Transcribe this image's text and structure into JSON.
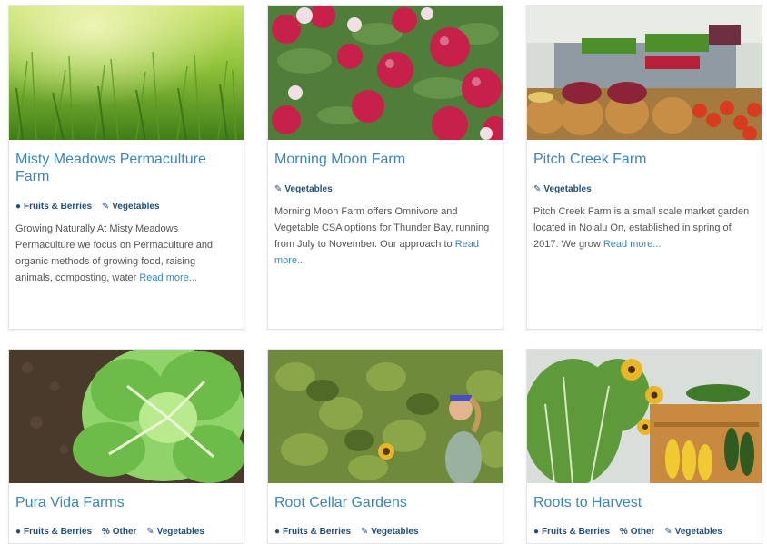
{
  "cards": [
    {
      "title": "Misty Meadows Permaculture Farm",
      "tags": [
        {
          "icon": "apple-icon",
          "label": "Fruits & Berries"
        },
        {
          "icon": "carrot-icon",
          "label": "Vegetables"
        }
      ],
      "description": "Growing Naturally At Misty Meadows Permaculture we focus on Permaculture and organic methods of growing food, raising animals, composting, water",
      "read_more": "Read more..."
    },
    {
      "title": "Morning Moon Farm",
      "tags": [
        {
          "icon": "carrot-icon",
          "label": "Vegetables"
        }
      ],
      "description": "Morning Moon Farm offers Omnivore and Vegetable CSA options for Thunder Bay, running from July to November. Our approach to",
      "read_more": "Read more..."
    },
    {
      "title": "Pitch Creek Farm",
      "tags": [
        {
          "icon": "carrot-icon",
          "label": "Vegetables"
        }
      ],
      "description": "Pitch Creek Farm is a small scale market garden located in Nolalu On, established in spring of 2017. We grow",
      "read_more": "Read more..."
    },
    {
      "title": "Pura Vida Farms",
      "tags": [
        {
          "icon": "apple-icon",
          "label": "Fruits & Berries"
        },
        {
          "icon": "other-icon",
          "label": "Other"
        },
        {
          "icon": "carrot-icon",
          "label": "Vegetables"
        }
      ]
    },
    {
      "title": "Root Cellar Gardens",
      "tags": [
        {
          "icon": "apple-icon",
          "label": "Fruits & Berries"
        },
        {
          "icon": "carrot-icon",
          "label": "Vegetables"
        }
      ]
    },
    {
      "title": "Roots to Harvest",
      "tags": [
        {
          "icon": "apple-icon",
          "label": "Fruits & Berries"
        },
        {
          "icon": "other-icon",
          "label": "Other"
        },
        {
          "icon": "carrot-icon",
          "label": "Vegetables"
        }
      ]
    }
  ],
  "colors": {
    "title": "#3a86b8",
    "tag": "#1f4e79",
    "text": "#555555"
  }
}
